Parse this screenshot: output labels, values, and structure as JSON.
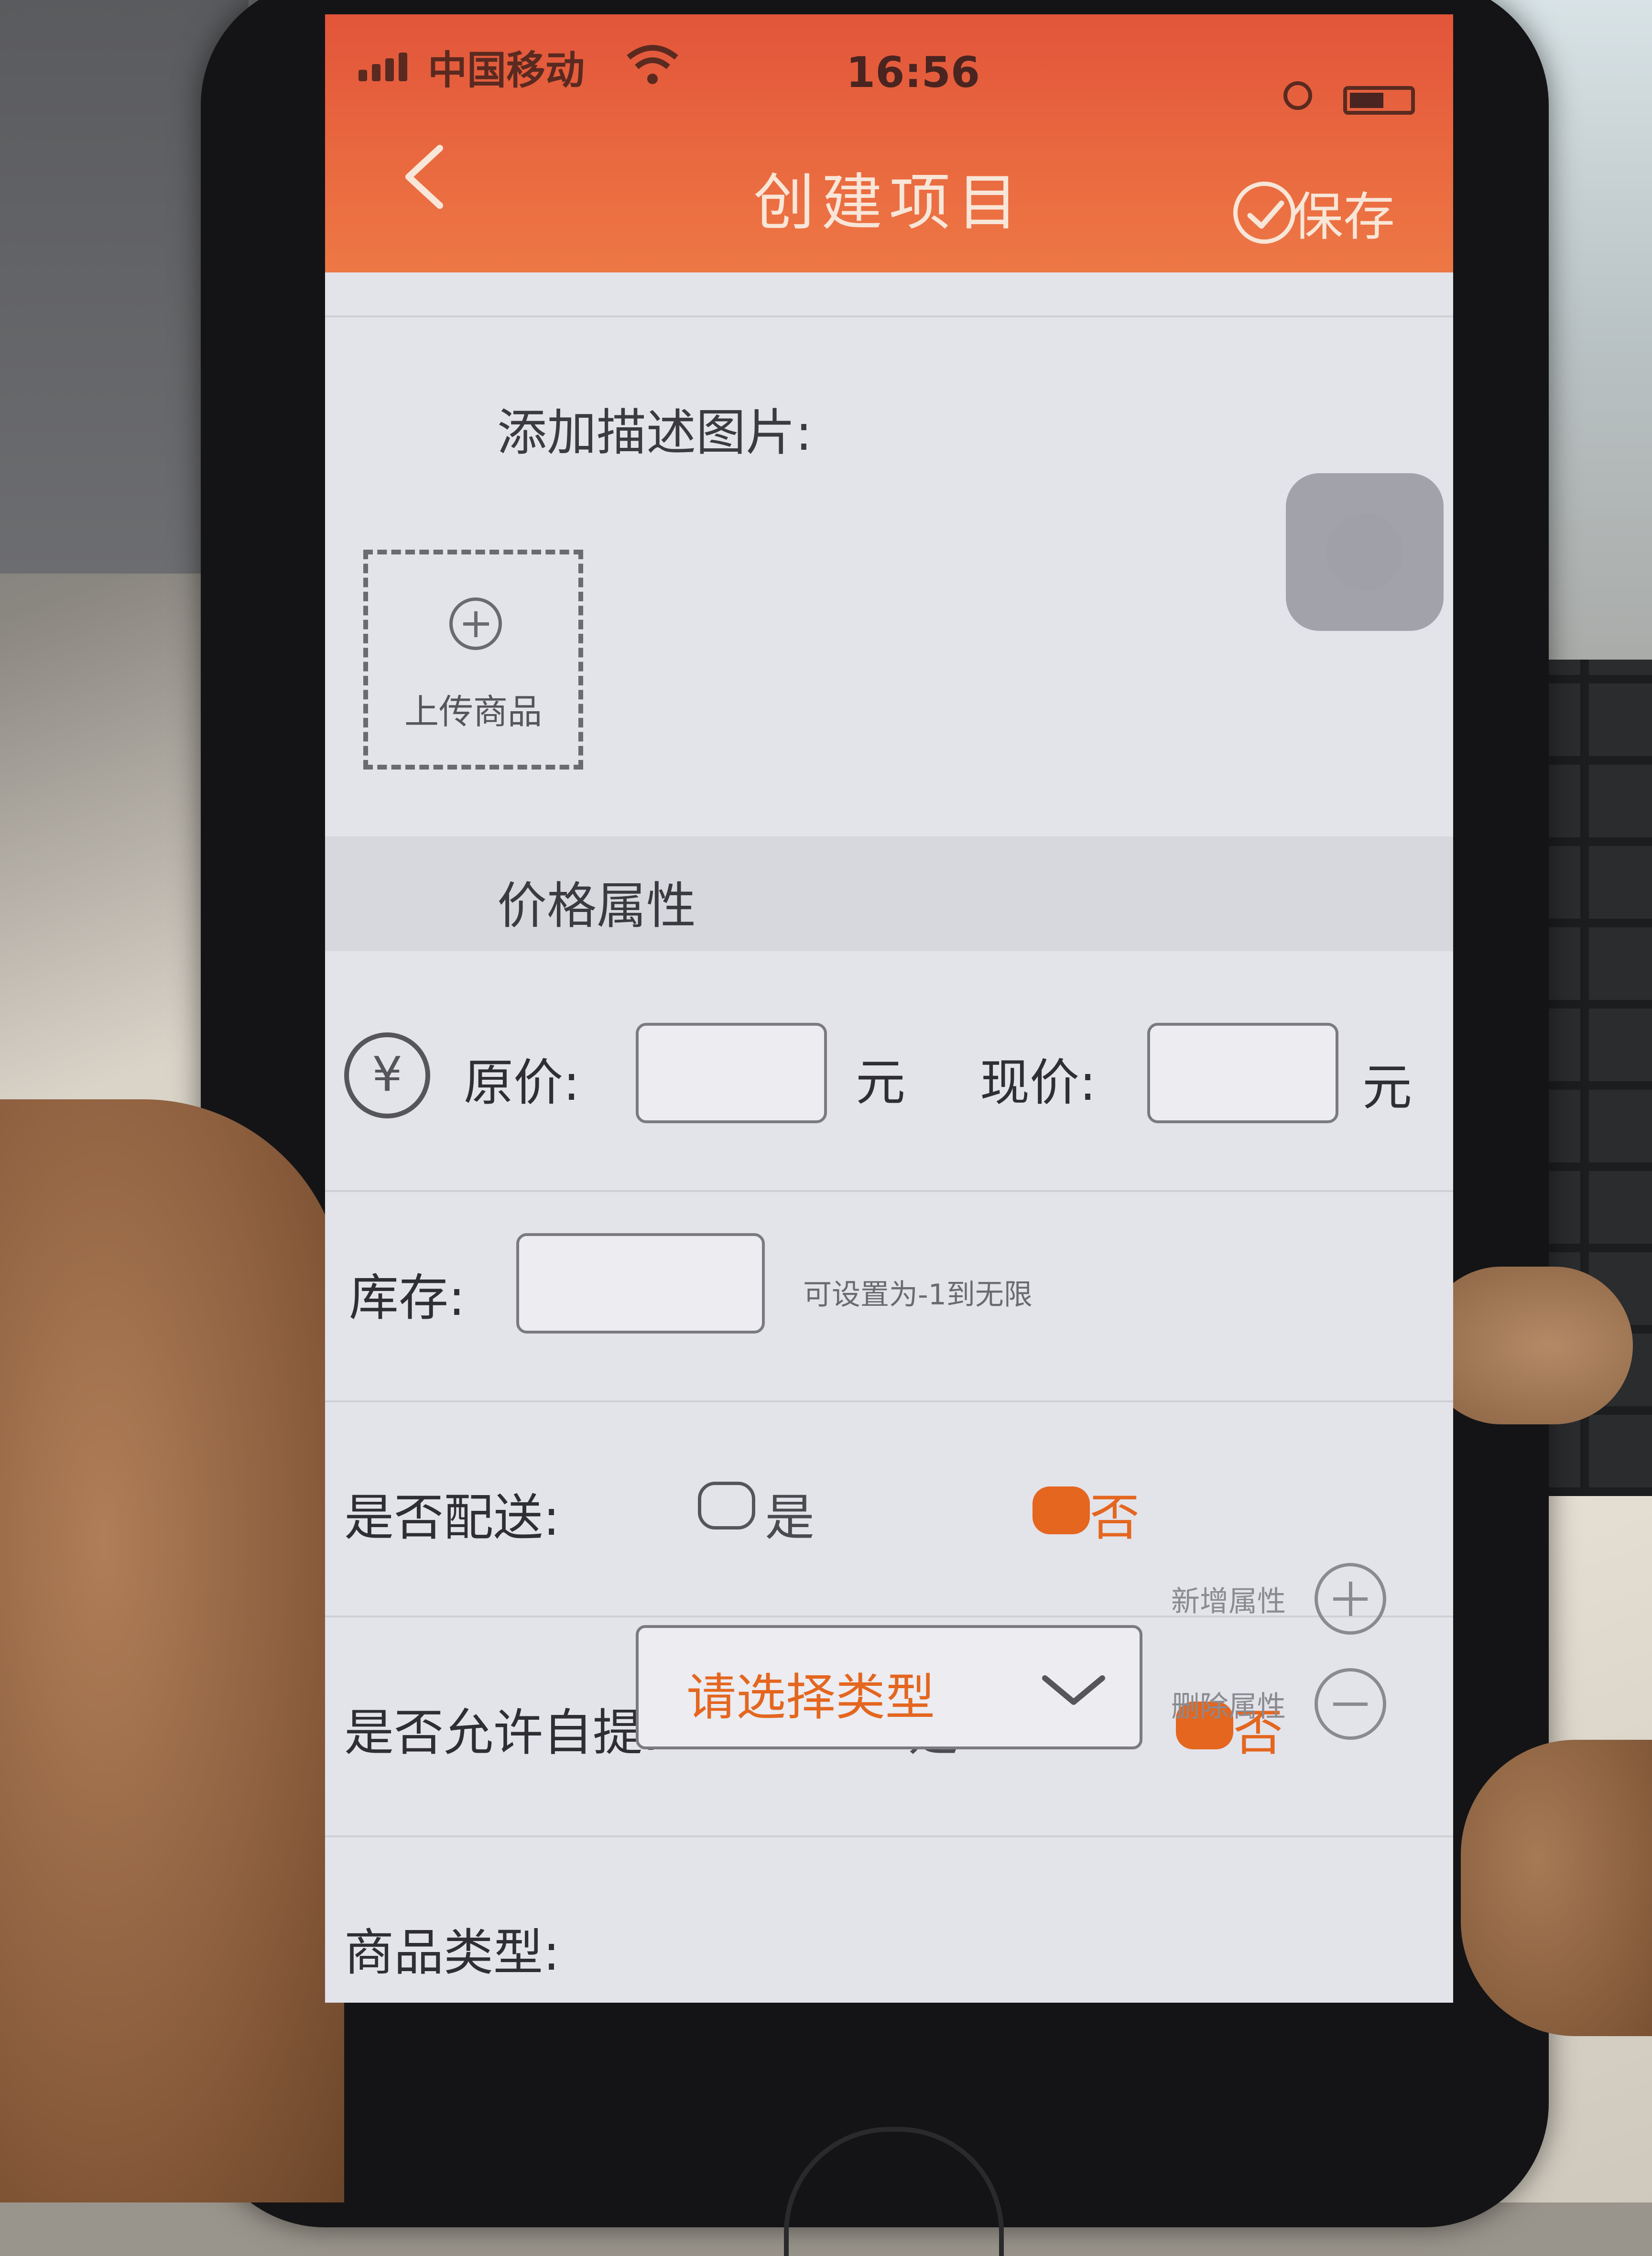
{
  "status_bar": {
    "carrier": "中国移动",
    "time": "16:56"
  },
  "header": {
    "title": "创建项目",
    "save_label": "保存"
  },
  "images_section": {
    "label": "添加描述图片:",
    "upload_label": "上传商品"
  },
  "price_section": {
    "title": "价格属性",
    "original_price_label": "原价:",
    "original_price_value": "",
    "original_price_unit": "元",
    "current_price_label": "现价:",
    "current_price_value": "",
    "current_price_unit": "元"
  },
  "stock": {
    "label": "库存:",
    "value": "",
    "hint": "可设置为-1到无限"
  },
  "delivery": {
    "label": "是否配送:",
    "option_yes": "是",
    "option_no": "否",
    "selected": "否"
  },
  "self_pickup": {
    "label": "是否允许自提:",
    "option_yes": "是",
    "option_no": "否",
    "selected": "否"
  },
  "product_type": {
    "label": "商品类型:",
    "placeholder": "请选择类型",
    "add_attribute_label": "新增属性",
    "remove_attribute_label": "删除属性"
  },
  "colors": {
    "header_orange": "#e95f3c",
    "accent_orange": "#e4661f",
    "screen_bg": "#e3e3ea"
  }
}
